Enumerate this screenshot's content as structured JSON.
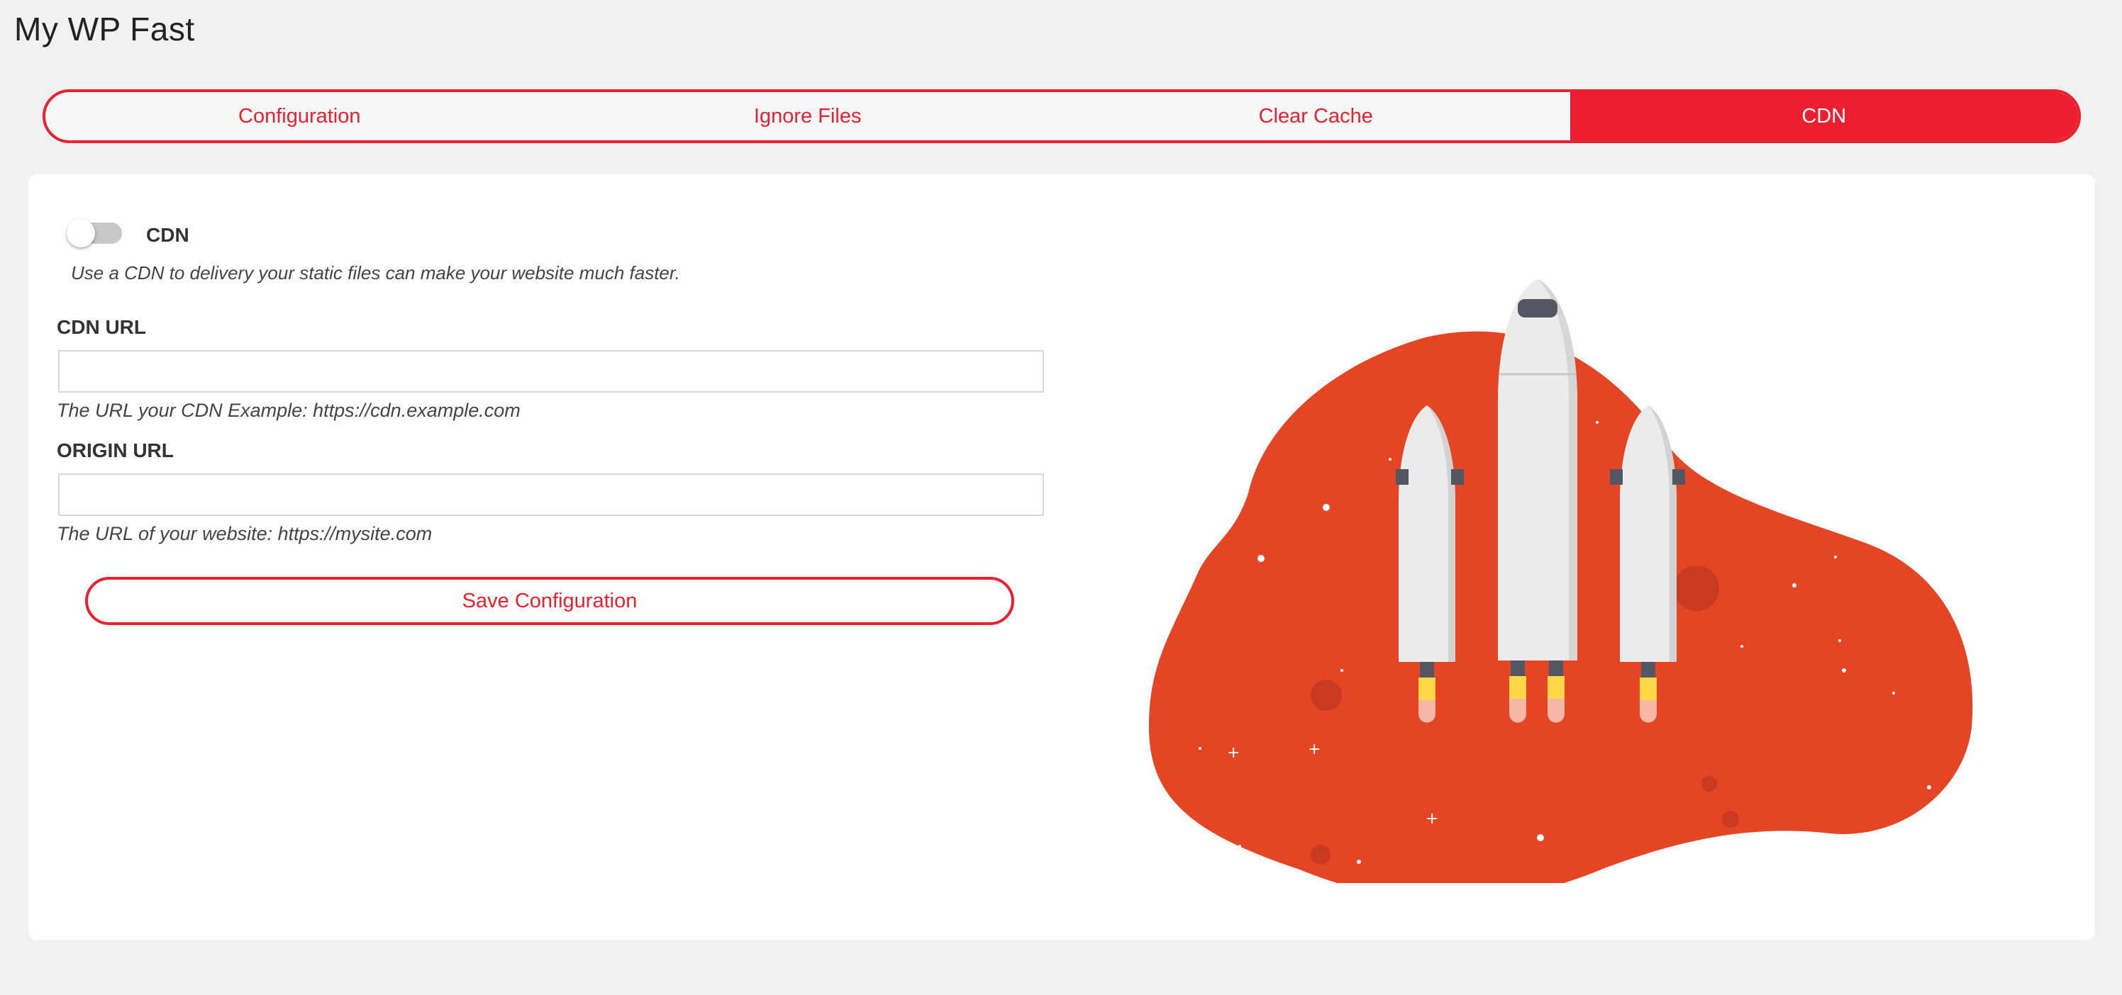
{
  "page": {
    "title": "My WP Fast"
  },
  "tabs": [
    {
      "label": "Configuration",
      "active": false
    },
    {
      "label": "Ignore Files",
      "active": false
    },
    {
      "label": "Clear Cache",
      "active": false
    },
    {
      "label": "CDN",
      "active": true
    }
  ],
  "cdn_toggle": {
    "label": "CDN",
    "enabled": false,
    "description": "Use a CDN to delivery your static files can make your website much faster."
  },
  "cdn_url": {
    "label": "CDN URL",
    "value": "",
    "help": "The URL your CDN Example: https://cdn.example.com"
  },
  "origin_url": {
    "label": "ORIGIN URL",
    "value": "",
    "help": "The URL of your website: https://mysite.com"
  },
  "save_button": {
    "label": "Save Configuration"
  },
  "illustration": {
    "icon": "rocket-launch-illustration",
    "colors": {
      "accent": "#ec1f31",
      "blob": "#e34525",
      "planet": "#c93a22",
      "rocket": "#ebebeb",
      "flame": "#ffd84a"
    }
  }
}
